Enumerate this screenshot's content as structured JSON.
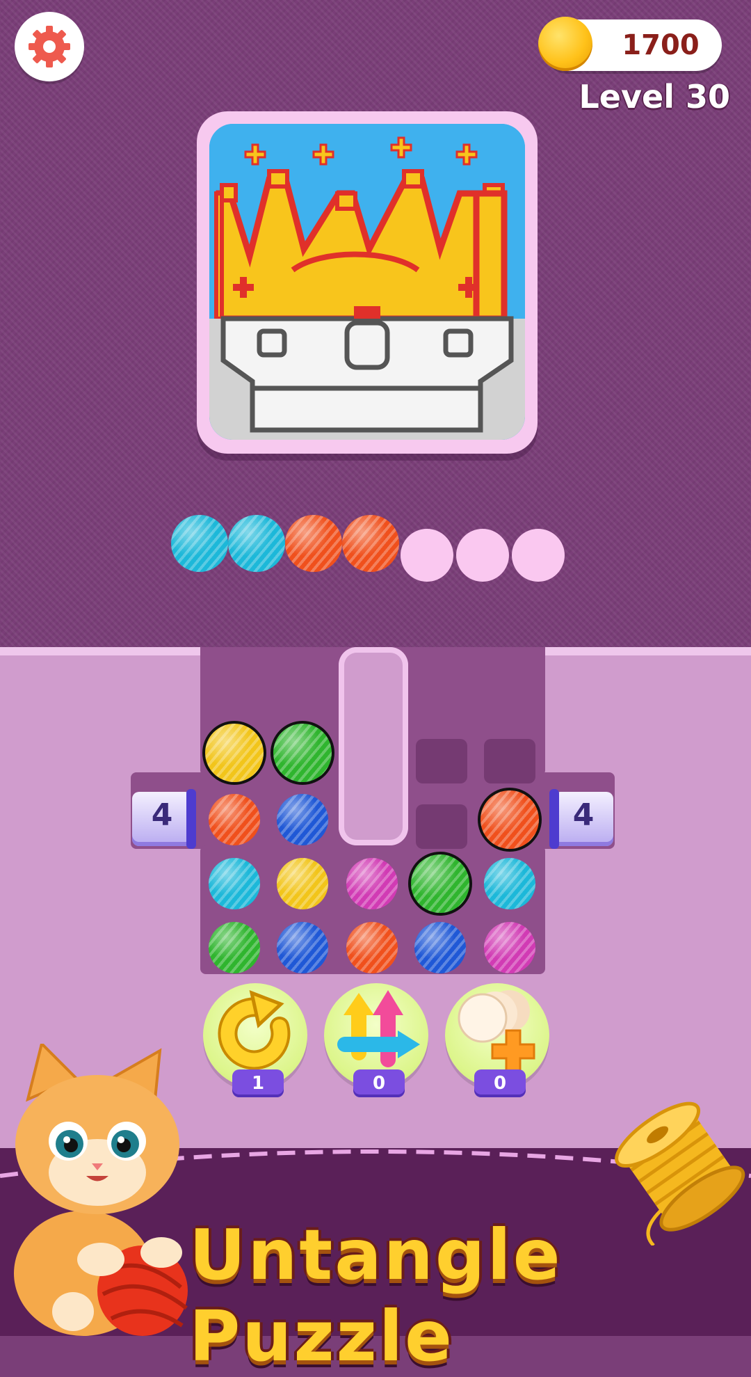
{
  "hud": {
    "coins": "1700",
    "level": "Level 30"
  },
  "booster_counts": [
    "1",
    "0",
    "0"
  ],
  "tube_left": "4",
  "tube_right": "4",
  "title": "Untangle Puzzle",
  "colors": {
    "cyan": "#1cb8d9",
    "orange": "#f0501c",
    "yellow": "#f2c51a",
    "green": "#2fb52e",
    "blue": "#1f58d6",
    "magenta": "#d13bb4"
  },
  "collected_row": [
    "cyan",
    "cyan",
    "orange",
    "orange",
    "empty",
    "empty",
    "empty"
  ],
  "grid": [
    [
      "yellow",
      "green",
      "wall",
      "empty",
      "empty"
    ],
    [
      "orange",
      "blue",
      "wall",
      "empty",
      "orange"
    ],
    [
      "cyan",
      "yellow",
      "magenta",
      "green",
      "cyan"
    ],
    [
      "green",
      "blue",
      "orange",
      "blue",
      "magenta"
    ]
  ]
}
